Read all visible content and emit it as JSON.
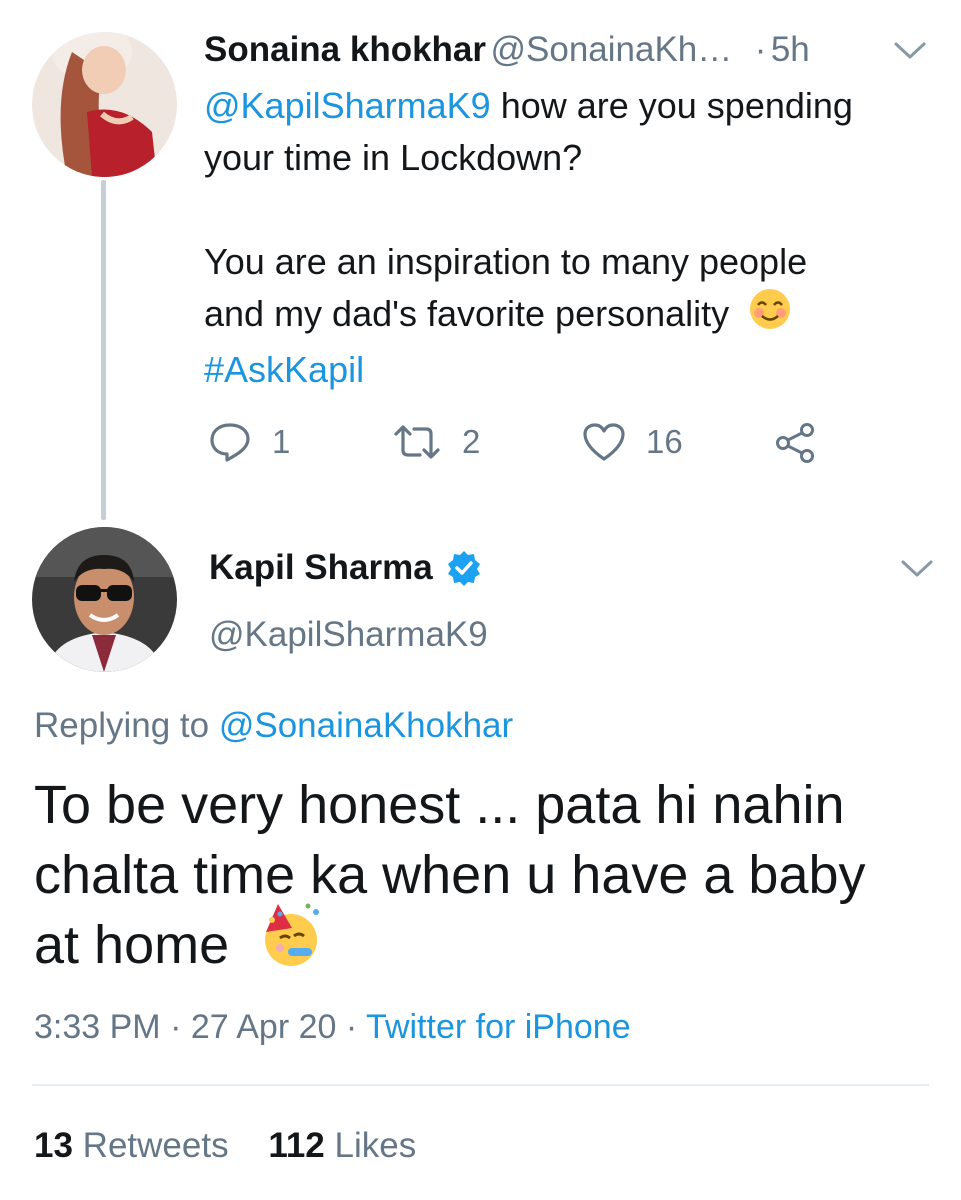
{
  "reply_to_tweet": {
    "author_name": "Sonaina khokhar",
    "author_handle": "@SonainaKh…",
    "time_dot": "·",
    "time": "5h",
    "mention": "@KapilSharmaK9",
    "text_line1_rest": " how are you spending",
    "text_line2": "your time in Lockdown?",
    "text_line3": "You are an inspiration to many people",
    "text_line4": "and my dad's favorite personality",
    "hashtag": "#AskKapil",
    "reply_count": "1",
    "retweet_count": "2",
    "like_count": "16"
  },
  "main_tweet": {
    "author_name": "Kapil Sharma",
    "author_handle": "@KapilSharmaK9",
    "replying_prefix": "Replying to",
    "replying_to": "@SonainaKhokhar",
    "text_line1": "To be very honest ... pata hi nahin",
    "text_line2": "chalta time ka when u have a baby",
    "text_line3": "at home",
    "time": "3:33 PM",
    "sep": "·",
    "date": "27 Apr 20",
    "source": "Twitter for iPhone",
    "retweets_count": "13",
    "retweets_label": "Retweets",
    "likes_count": "112",
    "likes_label": "Likes"
  },
  "colors": {
    "link": "#1b95e0",
    "muted": "#657786",
    "text": "#14171a",
    "verified": "#1da1f2"
  },
  "icons": [
    "reply-icon",
    "retweet-icon",
    "like-icon",
    "share-icon",
    "chevron-down-icon",
    "verified-badge-icon",
    "smiling-face-emoji",
    "partying-face-emoji"
  ]
}
